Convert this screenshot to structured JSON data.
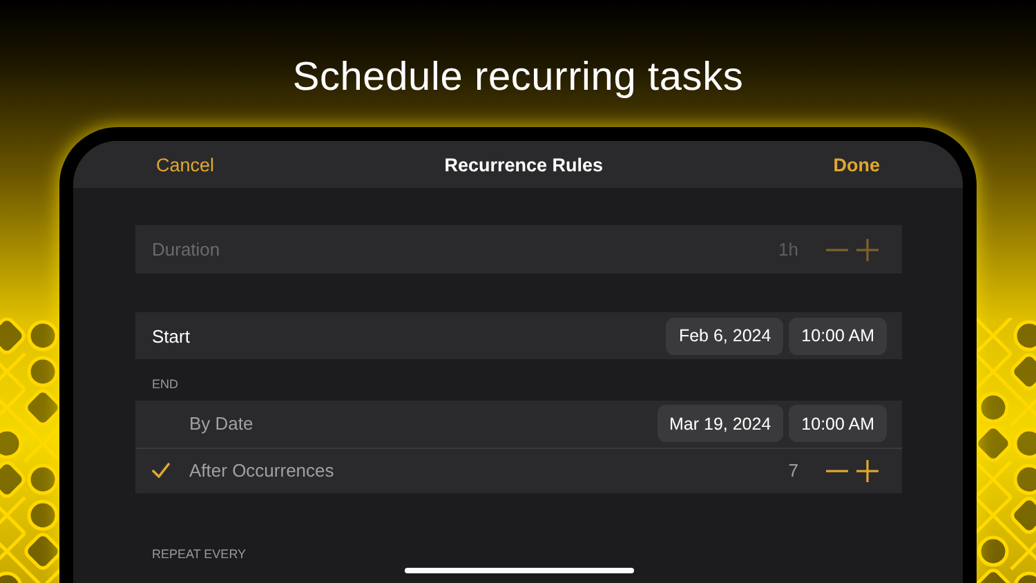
{
  "headline": "Schedule recurring tasks",
  "nav": {
    "cancel": "Cancel",
    "title": "Recurrence Rules",
    "done": "Done"
  },
  "duration": {
    "label": "Duration",
    "value": "1h",
    "disabled": true
  },
  "start": {
    "label": "Start",
    "date": "Feb 6, 2024",
    "time": "10:00 AM"
  },
  "end": {
    "header": "END",
    "options": [
      {
        "kind": "date",
        "label": "By Date",
        "selected": false,
        "date": "Mar 19, 2024",
        "time": "10:00 AM"
      },
      {
        "kind": "count",
        "label": "After Occurrences",
        "selected": true,
        "value": "7"
      }
    ]
  },
  "repeat": {
    "header": "REPEAT EVERY"
  }
}
